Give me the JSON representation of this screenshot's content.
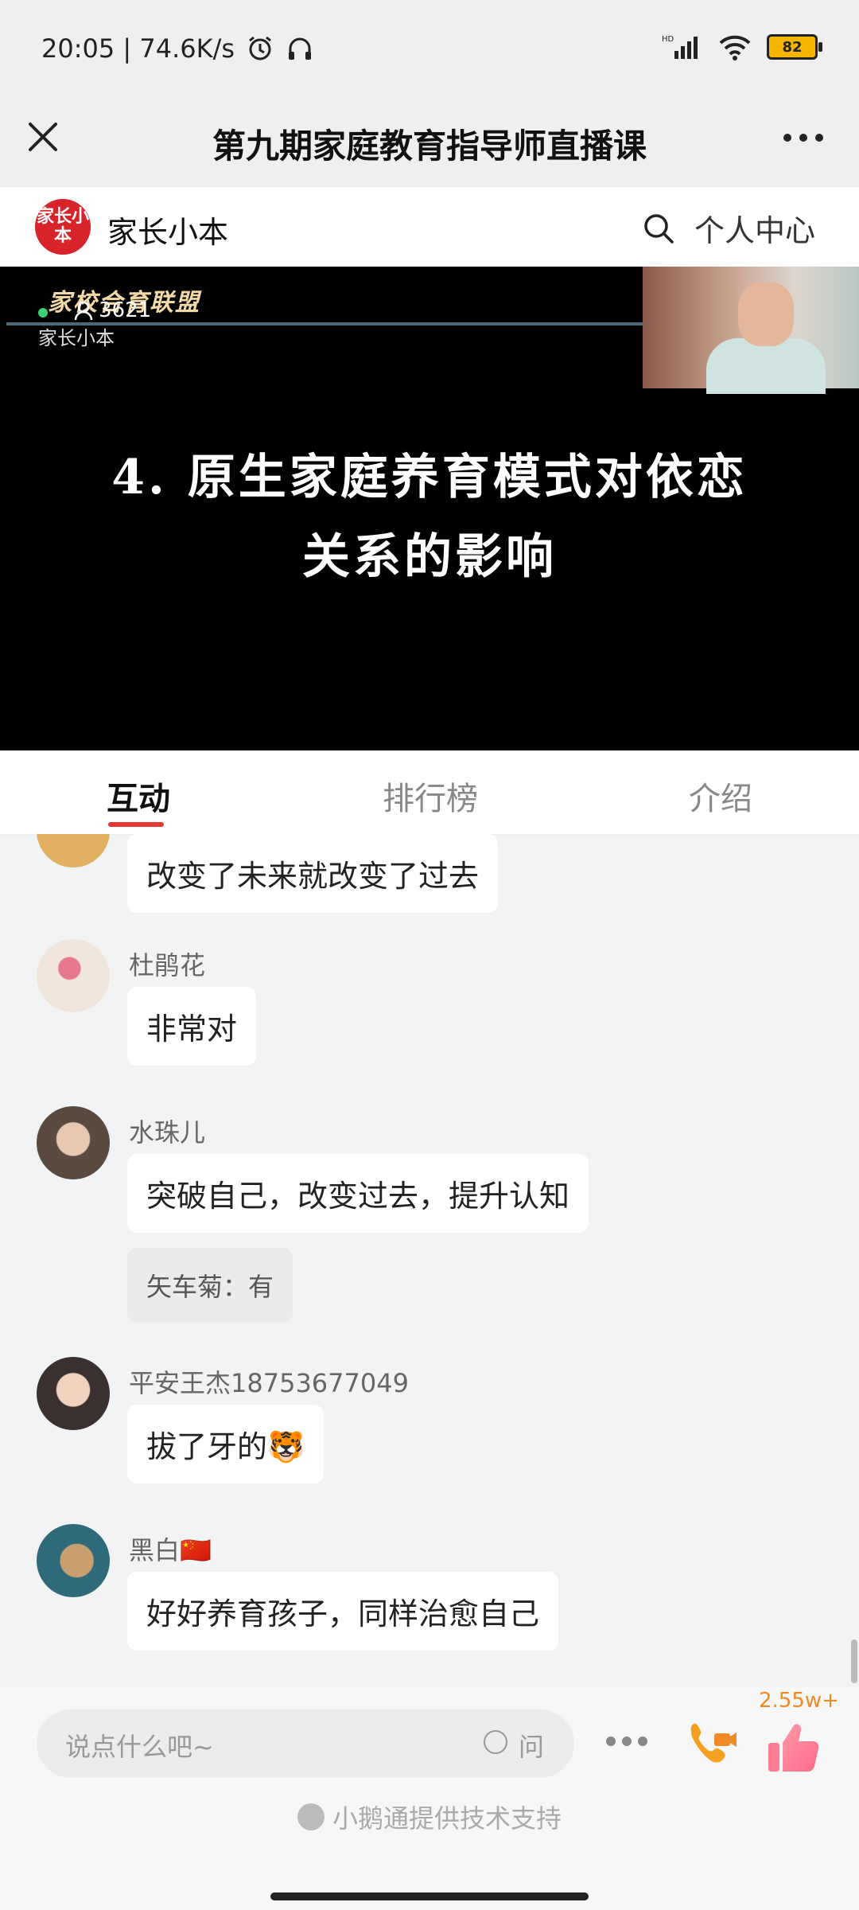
{
  "status": {
    "time_speed": "20:05 | 74.6K/s",
    "battery": "82"
  },
  "titlebar": {
    "title": "第九期家庭教育指导师直播课"
  },
  "brand": {
    "logo_text": "家长小本",
    "name": "家长小本",
    "personal_center": "个人中心"
  },
  "video": {
    "channel": "家校合育联盟",
    "channel_sub": "家长小本",
    "viewers": "3621",
    "slide_line1": "4. 原生家庭养育模式对依恋",
    "slide_line2": "关系的影响"
  },
  "tabs": [
    {
      "label": "互动"
    },
    {
      "label": "排行榜"
    },
    {
      "label": "介绍"
    }
  ],
  "messages": [
    {
      "name": "",
      "text": "改变了未来就改变了过去"
    },
    {
      "name": "杜鹃花",
      "text": "非常对"
    },
    {
      "name": "水珠儿",
      "text": "突破自己，改变过去，提升认知",
      "reply": "矢车菊：有"
    },
    {
      "name": "平安王杰18753677049",
      "text": "拔了牙的🐯"
    },
    {
      "name": "黑白🇨🇳",
      "text": "好好养育孩子，同样治愈自己"
    }
  ],
  "bottom": {
    "input_placeholder": "说点什么吧~",
    "ask_label": "问",
    "like_count": "2.55w+",
    "footer": "小鹅通提供技术支持"
  },
  "colors": {
    "accent_red": "#e53935",
    "like_orange": "#f08a24"
  }
}
